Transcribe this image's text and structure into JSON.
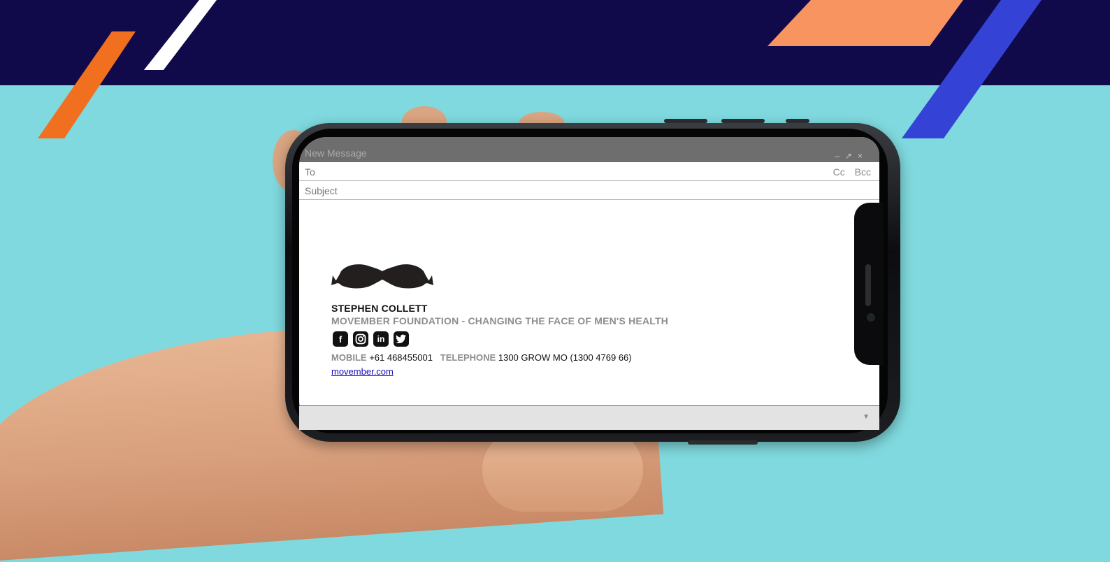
{
  "colors": {
    "background": "#7fd9de",
    "banner": "#10094a",
    "stripe_orange": "#f07020",
    "stripe_peach": "#f79460",
    "stripe_blue": "#3443d6",
    "stripe_white": "#ffffff",
    "link": "#1a0dbb"
  },
  "compose": {
    "title": "New Message",
    "to_label": "To",
    "cc_label": "Cc",
    "bcc_label": "Bcc",
    "subject_placeholder": "Subject"
  },
  "signature": {
    "logo_icon": "mustache-icon",
    "name": "STEPHEN COLLETT",
    "organization": "MOVEMBER FOUNDATION - CHANGING THE FACE OF MEN'S HEALTH",
    "social_icons": [
      "facebook-icon",
      "instagram-icon",
      "linkedin-icon",
      "twitter-icon"
    ],
    "mobile_label": "MOBILE",
    "mobile_value": "+61 468455001",
    "telephone_label": "TELEPHONE",
    "telephone_value": "1300 GROW MO (1300 4769 66)",
    "website": "movember.com"
  }
}
